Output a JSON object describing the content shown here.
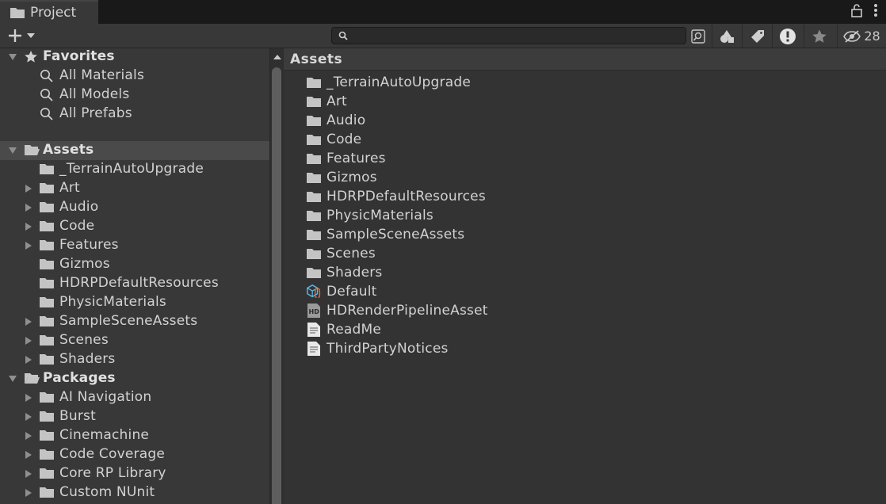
{
  "tab": {
    "title": "Project"
  },
  "toolbar": {
    "search_placeholder": "",
    "hidden_count": "28"
  },
  "tree": {
    "favorites": {
      "label": "Favorites",
      "items": [
        "All Materials",
        "All Models",
        "All Prefabs"
      ]
    },
    "assets": {
      "label": "Assets",
      "items": [
        {
          "label": "_TerrainAutoUpgrade",
          "expandable": false
        },
        {
          "label": "Art",
          "expandable": true
        },
        {
          "label": "Audio",
          "expandable": true
        },
        {
          "label": "Code",
          "expandable": true
        },
        {
          "label": "Features",
          "expandable": true
        },
        {
          "label": "Gizmos",
          "expandable": false
        },
        {
          "label": "HDRPDefaultResources",
          "expandable": false
        },
        {
          "label": "PhysicMaterials",
          "expandable": false
        },
        {
          "label": "SampleSceneAssets",
          "expandable": true
        },
        {
          "label": "Scenes",
          "expandable": true
        },
        {
          "label": "Shaders",
          "expandable": true
        }
      ]
    },
    "packages": {
      "label": "Packages",
      "items": [
        {
          "label": "AI Navigation",
          "expandable": true
        },
        {
          "label": "Burst",
          "expandable": true
        },
        {
          "label": "Cinemachine",
          "expandable": true
        },
        {
          "label": "Code Coverage",
          "expandable": true
        },
        {
          "label": "Core RP Library",
          "expandable": true
        },
        {
          "label": "Custom NUnit",
          "expandable": true
        }
      ]
    }
  },
  "content": {
    "header": "Assets",
    "items": [
      {
        "label": "_TerrainAutoUpgrade",
        "icon": "folder"
      },
      {
        "label": "Art",
        "icon": "folder"
      },
      {
        "label": "Audio",
        "icon": "folder"
      },
      {
        "label": "Code",
        "icon": "folder"
      },
      {
        "label": "Features",
        "icon": "folder"
      },
      {
        "label": "Gizmos",
        "icon": "folder"
      },
      {
        "label": "HDRPDefaultResources",
        "icon": "folder"
      },
      {
        "label": "PhysicMaterials",
        "icon": "folder"
      },
      {
        "label": "SampleSceneAssets",
        "icon": "folder"
      },
      {
        "label": "Scenes",
        "icon": "folder"
      },
      {
        "label": "Shaders",
        "icon": "folder"
      },
      {
        "label": "Default",
        "icon": "prefab-cube"
      },
      {
        "label": "HDRenderPipelineAsset",
        "icon": "hd-asset"
      },
      {
        "label": "ReadMe",
        "icon": "text-file"
      },
      {
        "label": "ThirdPartyNotices",
        "icon": "text-file"
      }
    ]
  },
  "colors": {
    "folder": "#c4c4c4",
    "panel": "#383838",
    "content_bg": "#333333",
    "selected": "#4a4a4a",
    "prefab_blue": "#59b5e6",
    "prefab_orange": "#e06a2c"
  }
}
